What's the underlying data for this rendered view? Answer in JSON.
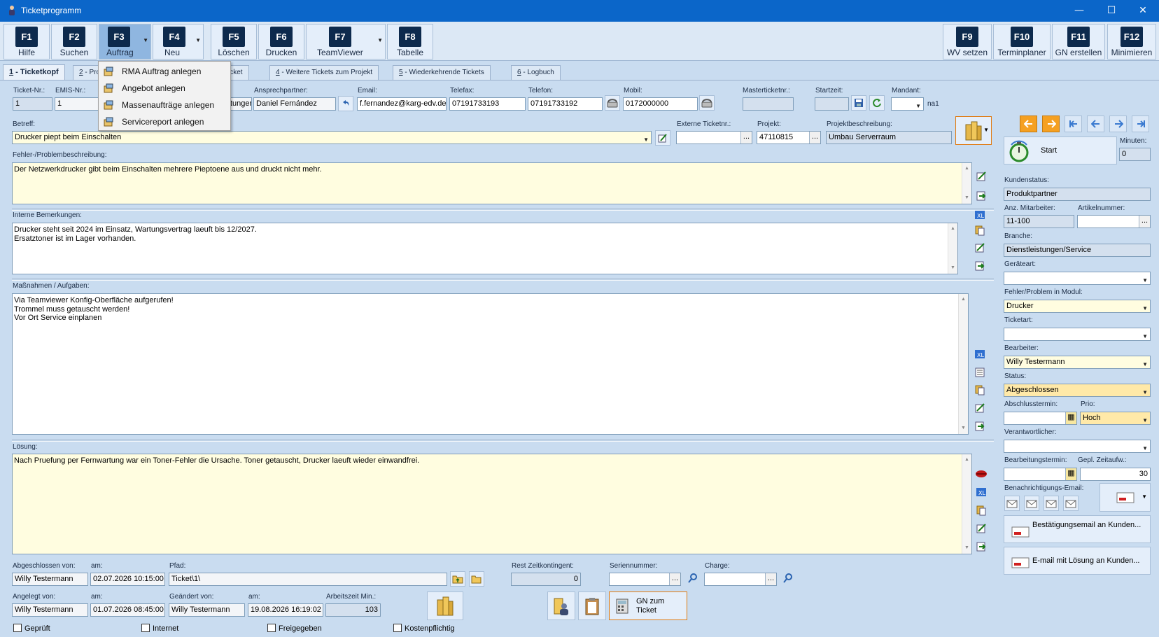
{
  "window": {
    "title": "Ticketprogramm",
    "minimize": "—",
    "maximize": "☐",
    "close": "✕"
  },
  "toolbar": {
    "buttons": [
      {
        "key": "F1",
        "label": "Hilfe"
      },
      {
        "key": "F2",
        "label": "Suchen"
      },
      {
        "key": "F3",
        "label": "Auftrag"
      },
      {
        "key": "F4",
        "label": "Neu"
      },
      {
        "key": "F5",
        "label": "Löschen"
      },
      {
        "key": "F6",
        "label": "Drucken"
      },
      {
        "key": "F7",
        "label": "TeamViewer"
      },
      {
        "key": "F8",
        "label": "Tabelle"
      },
      {
        "key": "F9",
        "label": "WV setzen"
      },
      {
        "key": "F10",
        "label": "Terminplaner"
      },
      {
        "key": "F11",
        "label": "GN erstellen"
      },
      {
        "key": "F12",
        "label": "Minimieren"
      }
    ]
  },
  "auftrag_menu": {
    "items": [
      "RMA Auftrag anlegen",
      "Angebot anlegen",
      "Massenaufträge anlegen",
      "Servicereport anlegen"
    ]
  },
  "tabs": {
    "t1_num": "1",
    "t1_label": " - Ticketkopf",
    "t2_num": "2",
    "t2_label": " - Pro",
    "t3_label": "icket",
    "t4_num": "4",
    "t4_label": " - Weitere Tickets zum Projekt",
    "t5_num": "5",
    "t5_label": " - Wiederkehrende Tickets",
    "t6_num": "6",
    "t6_label": " - Logbuch"
  },
  "header": {
    "ticket_nr_label": "Ticket-Nr.:",
    "ticket_nr": "1",
    "emis_nr_label": "EMIS-Nr.:",
    "emis_nr": "1",
    "firma_partial": "tunger",
    "ansprechpartner_label": "Ansprechpartner:",
    "ansprechpartner": "Daniel Fernández",
    "email_label": "Email:",
    "email": "f.fernandez@karg-edv.de",
    "telefax_label": "Telefax:",
    "telefax": "07191733193",
    "telefon_label": "Telefon:",
    "telefon": "07191733192",
    "mobil_label": "Mobil:",
    "mobil": "0172000000",
    "masterticket_label": "Masterticketnr.:",
    "masterticket": "",
    "startzeit_label": "Startzeit:",
    "startzeit": "",
    "mandant_label": "Mandant:",
    "mandant": "",
    "mandant_suffix": "na1"
  },
  "betreff": {
    "label": "Betreff:",
    "value": "Drucker piept beim Einschalten",
    "ext_ticket_label": "Externe Ticketnr.:",
    "ext_ticket": "",
    "projekt_label": "Projekt:",
    "projekt": "47110815",
    "projektbeschr_label": "Projektbeschreibung:",
    "projektbeschr": "Umbau Serverraum"
  },
  "fehler": {
    "label": "Fehler-/Problembeschreibung:",
    "text": "Der Netzwerkdrucker gibt beim Einschalten mehrere Pieptoene aus und druckt nicht mehr."
  },
  "interne": {
    "label": "Interne Bemerkungen:",
    "text": "Drucker steht seit 2024 im Einsatz, Wartungsvertrag laeuft bis 12/2027.\nErsatztoner ist im Lager vorhanden."
  },
  "massnahmen": {
    "label": "Maßnahmen / Aufgaben:",
    "text": "Via Teamviewer Konfig-Oberfläche aufgerufen!\nTrommel muss getauscht werden!\nVor Ort Service einplanen"
  },
  "loesung": {
    "label": "Lösung:",
    "text": "Nach Pruefung per Fernwartung war ein Toner-Fehler die Ursache. Toner getauscht, Drucker laeuft wieder einwandfrei."
  },
  "footer": {
    "abgeschlossen_von_label": "Abgeschlossen von:",
    "abgeschlossen_von": "Willy Testermann",
    "am_label": "am:",
    "abgeschlossen_am": "02.07.2026 10:15:00",
    "pfad_label": "Pfad:",
    "pfad": "Ticket\\1\\",
    "rest_label": "Rest Zeitkontingent:",
    "rest": "0",
    "seriennummer_label": "Seriennummer:",
    "seriennummer": "",
    "charge_label": "Charge:",
    "charge": "",
    "angelegt_von_label": "Angelegt von:",
    "angelegt_von": "Willy Testermann",
    "angelegt_am": "01.07.2026 08:45:00",
    "geaendert_von_label": "Geändert von:",
    "geaendert_von": "Willy Testermann",
    "geaendert_am": "19.08.2026 16:19:02",
    "arbeitszeit_label": "Arbeitszeit Min.:",
    "arbeitszeit": "103",
    "gn_button": "GN zum Ticket",
    "checkboxes": [
      "Geprüft",
      "Internet",
      "Freigegeben",
      "Kostenpflichtig"
    ]
  },
  "right": {
    "start_label": "Start",
    "minuten_label": "Minuten:",
    "minuten": "0",
    "kundenstatus_label": "Kundenstatus:",
    "kundenstatus": "Produktpartner",
    "mitarbeiter_label": "Anz. Mitarbeiter:",
    "mitarbeiter": "11-100",
    "artikelnummer_label": "Artikelnummer:",
    "artikelnummer": "",
    "branche_label": "Branche:",
    "branche": "Dienstleistungen/Service",
    "geraeteart_label": "Geräteart:",
    "geraeteart": "",
    "modul_label": "Fehler/Problem in Modul:",
    "modul": "Drucker",
    "ticketart_label": "Ticketart:",
    "ticketart": "",
    "bearbeiter_label": "Bearbeiter:",
    "bearbeiter": "Willy Testermann",
    "status_label": "Status:",
    "status": "Abgeschlossen",
    "abschlusstermin_label": "Abschlusstermin:",
    "abschlusstermin": "",
    "prio_label": "Prio:",
    "prio": "Hoch",
    "verantwortlicher_label": "Verantwortlicher:",
    "verantwortlicher": "",
    "bearbeitungstermin_label": "Bearbeitungstermin:",
    "bearbeitungstermin": "",
    "zeitaufw_label": "Gepl. Zeitaufw.:",
    "zeitaufw": "30",
    "benachrichtigung_label": "Benachrichtigungs-Email:",
    "bestaetigung_btn": "Bestätigungsemail an Kunden...",
    "loesung_mail_btn": "E-mail mit Lösung an Kunden..."
  }
}
